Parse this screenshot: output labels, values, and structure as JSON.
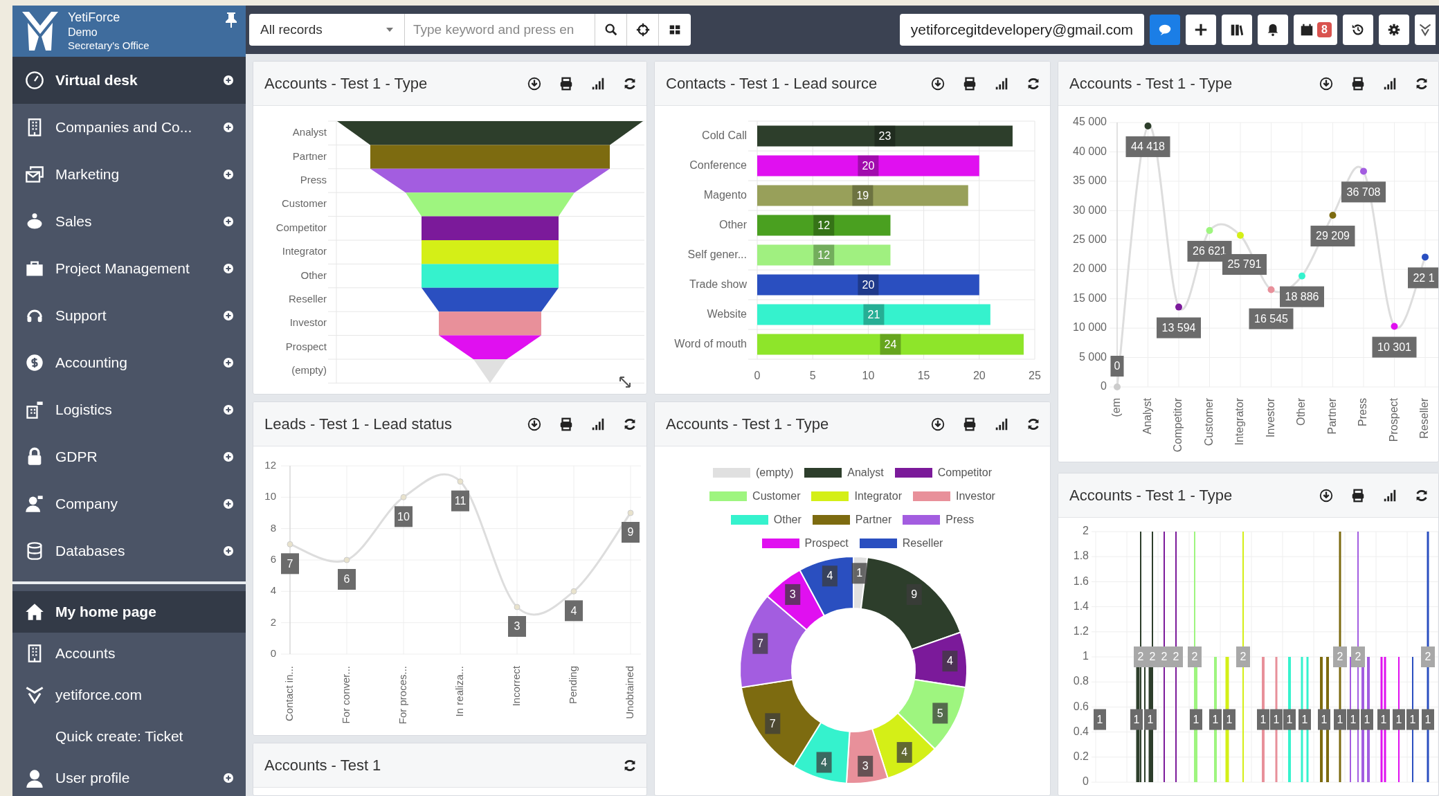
{
  "sidebar": {
    "brand": {
      "name": "YetiForce",
      "line_2": "Demo",
      "line_3": "Secretary's Office"
    },
    "items": [
      {
        "label": "Virtual desk",
        "selected": true,
        "expandable": true
      },
      {
        "label": "Companies and Co...",
        "selected": false,
        "expandable": true
      },
      {
        "label": "Marketing",
        "selected": false,
        "expandable": true
      },
      {
        "label": "Sales",
        "selected": false,
        "expandable": true
      },
      {
        "label": "Project Management",
        "selected": false,
        "expandable": true
      },
      {
        "label": "Support",
        "selected": false,
        "expandable": true
      },
      {
        "label": "Accounting",
        "selected": false,
        "expandable": true
      },
      {
        "label": "Logistics",
        "selected": false,
        "expandable": true
      },
      {
        "label": "GDPR",
        "selected": false,
        "expandable": true
      },
      {
        "label": "Company",
        "selected": false,
        "expandable": true
      },
      {
        "label": "Databases",
        "selected": false,
        "expandable": true
      }
    ],
    "shortcuts": [
      {
        "label": "My home page",
        "selected": true,
        "expandable": false
      },
      {
        "label": "Accounts",
        "selected": false,
        "expandable": false
      },
      {
        "label": "yetiforce.com",
        "selected": false,
        "expandable": false
      },
      {
        "label": "Quick create: Ticket",
        "selected": false,
        "expandable": false
      },
      {
        "label": "User profile",
        "selected": false,
        "expandable": true
      }
    ]
  },
  "top_bar": {
    "scope_select": "All records",
    "search": {
      "placeholder": "Type keyword and press en"
    },
    "user_email": "yetiforcegitdevelopery@gmail.com",
    "calendar_badge": "8"
  },
  "columns": [
    [
      {
        "title": "Accounts - Test 1 - Type",
        "kind": "funnel",
        "chart_tools": true,
        "labels": [
          "Analyst",
          "Partner",
          "Press",
          "Customer",
          "Competitor",
          "Integrator",
          "Other",
          "Reseller",
          "Investor",
          "Prospect",
          "(empty)"
        ]
      },
      {
        "title": "Leads - Test 1 - Lead status",
        "kind": "line_small",
        "chart_tools": true,
        "chart_data": {
          "type": "line",
          "categories": [
            "Contact in...",
            "For conver...",
            "For proces...",
            "In realiza...",
            "Incorrect",
            "Pending",
            "Unobtained"
          ],
          "series": [
            {
              "color": "#dddddd",
              "marker": true,
              "values": [
                7,
                6,
                10,
                11,
                3,
                4,
                9
              ]
            }
          ],
          "grid": true,
          "ylim": [
            0,
            12
          ],
          "yticks": [
            0,
            2,
            4,
            6,
            8,
            10,
            12
          ],
          "data_labels": true
        }
      },
      {
        "title": "Accounts - Test 1",
        "kind": "empty",
        "chart_tools": false
      }
    ],
    [
      {
        "title": "Contacts - Test 1 - Lead source",
        "kind": "hbar",
        "chart_tools": true,
        "chart_data": {
          "type": "bar",
          "orientation": "horizontal",
          "categories": [
            "Cold Call",
            "Conference",
            "Magento",
            "Other",
            "Self gener...",
            "Trade show",
            "Website",
            "Word of mouth"
          ],
          "values": [
            23,
            20,
            19,
            12,
            12,
            20,
            21,
            24
          ],
          "colors": [
            "#2d3e2b",
            "#e010f0",
            "#98a05a",
            "#4aa020",
            "#a0f080",
            "#2a4fc0",
            "#35f2cd",
            "#8ee52a"
          ],
          "xlim": [
            0,
            25
          ],
          "xticks": [
            0,
            5,
            10,
            15,
            20,
            25
          ],
          "grid": true,
          "data_labels": true
        }
      },
      {
        "title": "Accounts - Test 1 - Type",
        "kind": "donut",
        "chart_tools": true,
        "chart_data": {
          "type": "donut",
          "categories": [
            "(empty)",
            "Analyst",
            "Competitor",
            "Customer",
            "Integrator",
            "Investor",
            "Other",
            "Partner",
            "Press",
            "Prospect",
            "Reseller"
          ],
          "values": [
            1,
            9,
            4,
            5,
            4,
            3,
            4,
            7,
            7,
            3,
            4
          ],
          "colors": [
            "#e0e0e0",
            "#2d3e2b",
            "#7b1a9a",
            "#9ef57f",
            "#d4ef17",
            "#e8909a",
            "#35f2cd",
            "#7d6b10",
            "#a35de0",
            "#e010f0",
            "#2a4fc0"
          ],
          "data_labels": true
        }
      }
    ],
    [
      {
        "title": "Accounts - Test 1 - Type",
        "kind": "line_big",
        "chart_tools": true,
        "chart_data": {
          "type": "line",
          "categories": [
            "(em",
            "Analyst",
            "Competitor",
            "Customer",
            "Integrator",
            "Investor",
            "Other",
            "Partner",
            "Press",
            "Prospect",
            "Reseller"
          ],
          "series": [
            {
              "color": "#dddddd",
              "marker": true,
              "values": [
                0,
                44418,
                13594,
                26621,
                25791,
                16545,
                18886,
                29209,
                36708,
                10301,
                22100
              ]
            }
          ],
          "grid": true,
          "value_labels": [
            "0",
            "44 418",
            "13 594",
            "26 621",
            "25 791",
            "16 545",
            "18 886",
            "29 209",
            "36 708",
            "10 301",
            "22 1"
          ],
          "ylim": [
            0,
            45000
          ],
          "yticks": [
            {
              "value": 0,
              "label": "0"
            },
            {
              "value": 5000,
              "label": "5 000"
            },
            {
              "value": 10000,
              "label": "10 000"
            },
            {
              "value": 15000,
              "label": "15 000"
            },
            {
              "value": 20000,
              "label": "20 000"
            },
            {
              "value": 25000,
              "label": "25 000"
            },
            {
              "value": 30000,
              "label": "30 000"
            },
            {
              "value": 35000,
              "label": "35 000"
            },
            {
              "value": 40000,
              "label": "40 000"
            },
            {
              "value": 45000,
              "label": "45 000"
            }
          ]
        }
      },
      {
        "title": "Accounts - Test 1 - Type",
        "kind": "spikes",
        "chart_tools": true,
        "y_labels": [
          "2",
          "1.8",
          "1.6",
          "1.4",
          "1.2",
          "1",
          "0.8",
          "0.6",
          "0.4",
          "0.2",
          "0"
        ],
        "upper_labels": [
          "2",
          "2",
          "2",
          "2",
          "2",
          "2",
          "2",
          "2",
          "2"
        ],
        "lower_labels": [
          "1",
          "1",
          "1",
          "1",
          "1",
          "1",
          "1",
          "1",
          "1",
          "1",
          "1",
          "1",
          "1",
          "1",
          "1",
          "1",
          "1",
          "1"
        ]
      }
    ]
  ]
}
